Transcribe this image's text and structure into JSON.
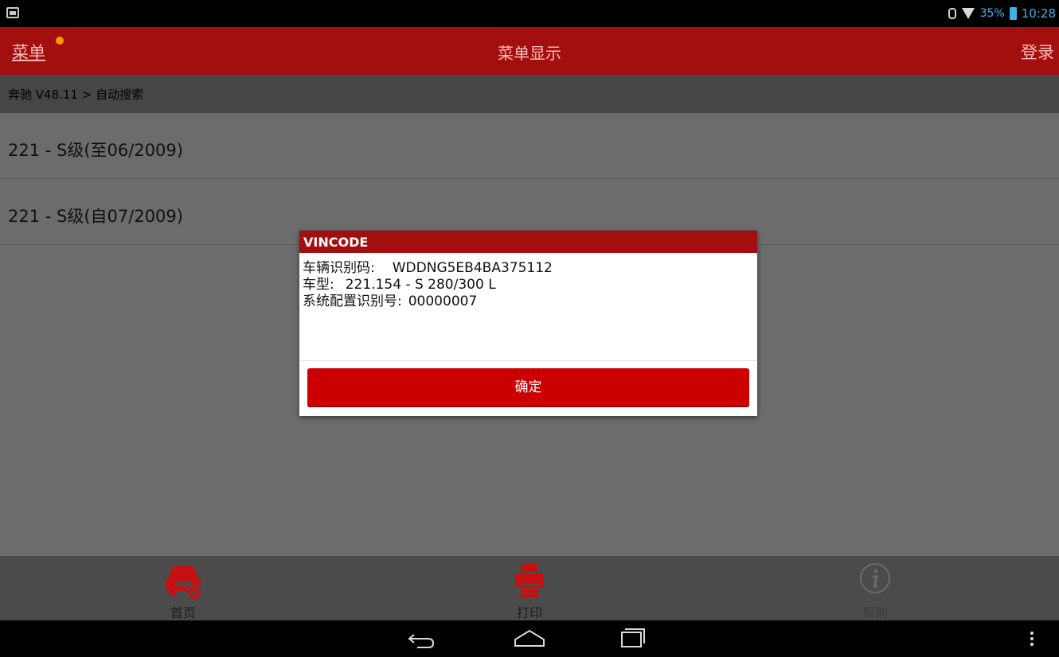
{
  "status_bar": {
    "battery_percent": "35%",
    "time": "10:28",
    "icons": [
      "image-icon",
      "bluetooth-icon",
      "wifi-icon",
      "battery-icon"
    ],
    "accent_color": "#3fb0e8"
  },
  "header": {
    "menu_label": "菜单",
    "title": "菜单显示",
    "login_label": "登录",
    "bg_color": "#a30f0f"
  },
  "breadcrumb": {
    "text": "奔驰 V48.11 > 自动搜索"
  },
  "list": {
    "items": [
      {
        "label": "221 - S级(至06/2009)"
      },
      {
        "label": "221 - S级(自07/2009)"
      }
    ]
  },
  "dialog": {
    "title": "VINCODE",
    "rows": [
      {
        "label": "车辆识别码:",
        "value": "WDDNG5EB4BA375112"
      },
      {
        "label": "车型:",
        "value": "221.154 - S 280/300 L"
      },
      {
        "label": "系统配置识别号:",
        "value": "00000007"
      }
    ],
    "ok_label": "确定"
  },
  "toolbar": {
    "items": [
      {
        "label": "首页",
        "icon": "car-home-icon"
      },
      {
        "label": "打印",
        "icon": "printer-icon"
      },
      {
        "label": "帮助",
        "icon": "info-icon"
      }
    ]
  },
  "navbar": {
    "icons": [
      "back-icon",
      "home-icon",
      "recent-apps-icon",
      "more-menu-icon"
    ]
  }
}
